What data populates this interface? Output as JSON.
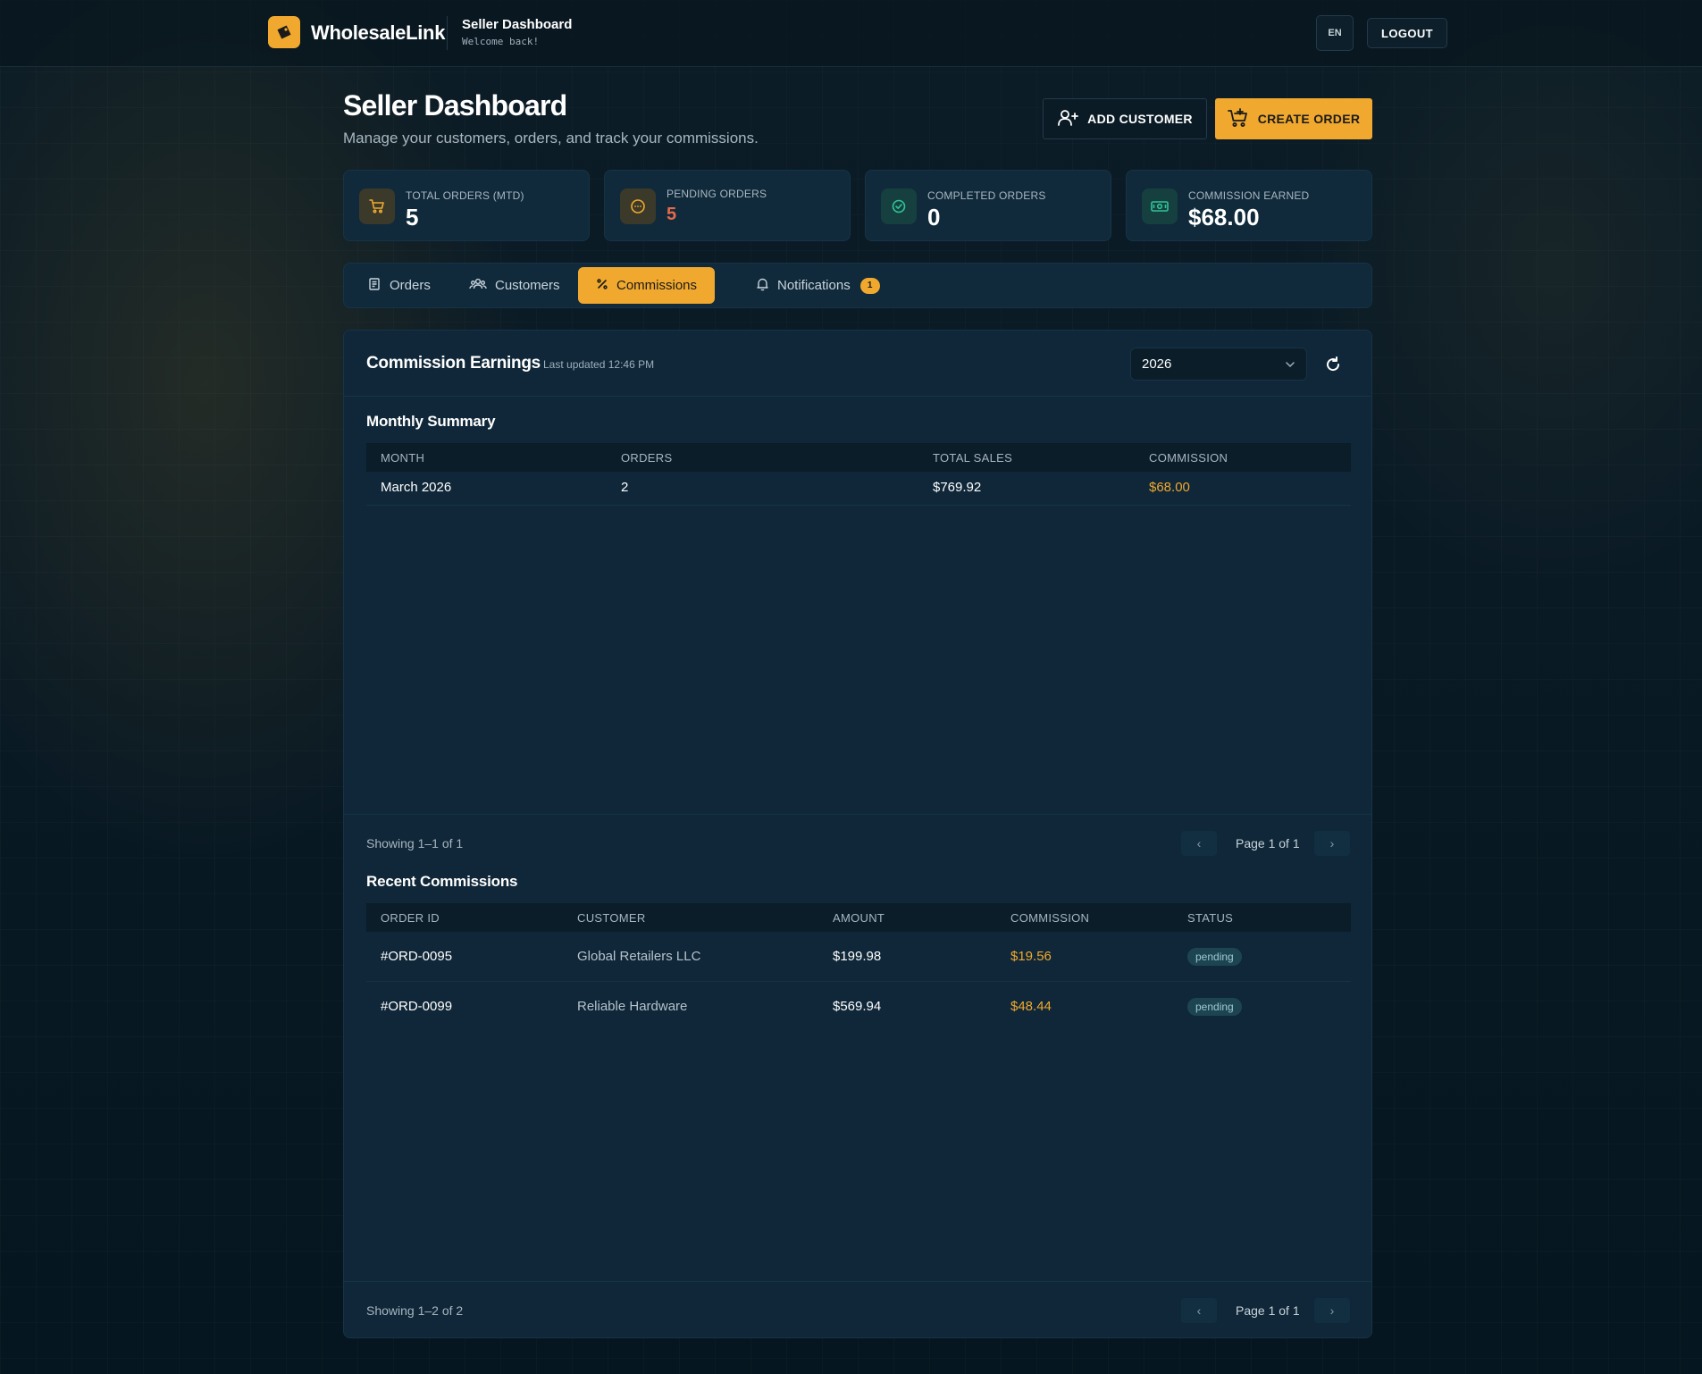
{
  "topbar": {
    "brand": "WholesaleLink",
    "title": "Seller Dashboard",
    "subtitle": "Welcome back!",
    "lang": "EN",
    "logout": "LOGOUT"
  },
  "header": {
    "title": "Seller Dashboard",
    "subtitle": "Manage your customers, orders, and track your commissions.",
    "add_customer": "ADD CUSTOMER",
    "create_order": "CREATE ORDER"
  },
  "stats": [
    {
      "label": "TOTAL ORDERS (MTD)",
      "value": "5",
      "icon": "cart-icon"
    },
    {
      "label": "PENDING ORDERS",
      "value": "5",
      "icon": "clock-icon"
    },
    {
      "label": "COMPLETED ORDERS",
      "value": "0",
      "icon": "check-circle-icon"
    },
    {
      "label": "COMMISSION EARNED",
      "value": "$68.00",
      "icon": "cash-icon"
    }
  ],
  "tabs": [
    {
      "label": "Orders",
      "icon": "receipt-icon"
    },
    {
      "label": "Customers",
      "icon": "users-icon"
    },
    {
      "label": "Commissions",
      "icon": "percent-icon",
      "active": true
    },
    {
      "label": "Notifications",
      "icon": "bell-icon",
      "badge": "1"
    }
  ],
  "commissions": {
    "title": "Commission Earnings",
    "updated": "Last updated 12:46 PM",
    "year": "2026",
    "monthly": {
      "title": "Monthly Summary",
      "columns": [
        "MONTH",
        "ORDERS",
        "TOTAL SALES",
        "COMMISSION"
      ],
      "rows": [
        {
          "month": "March 2026",
          "orders": "2",
          "sales": "$769.92",
          "commission": "$68.00"
        }
      ],
      "showing": "Showing 1–1 of 1",
      "page": "Page 1 of 1"
    },
    "recent": {
      "title": "Recent Commissions",
      "columns": [
        "ORDER ID",
        "CUSTOMER",
        "AMOUNT",
        "COMMISSION",
        "STATUS"
      ],
      "rows": [
        {
          "order_id": "#ORD-0095",
          "customer": "Global Retailers LLC",
          "amount": "$199.98",
          "commission": "$19.56",
          "status": "pending"
        },
        {
          "order_id": "#ORD-0099",
          "customer": "Reliable Hardware",
          "amount": "$569.94",
          "commission": "$48.44",
          "status": "pending"
        }
      ],
      "showing": "Showing 1–2 of 2",
      "page": "Page 1 of 1"
    }
  },
  "colors": {
    "accent": "#f0a92e",
    "pending_value": "#e8694a",
    "background": "#0a1a25",
    "card": "#102a3b"
  }
}
